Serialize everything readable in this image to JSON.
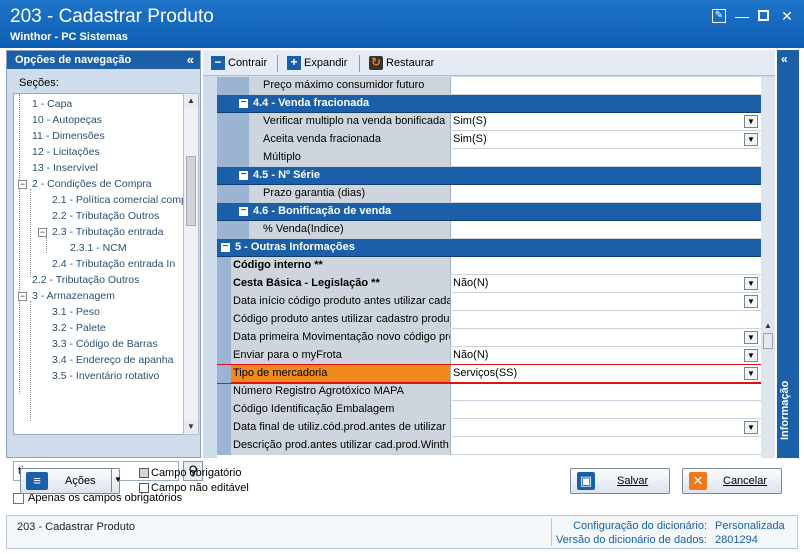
{
  "window": {
    "title": "203 - Cadastrar  Produto",
    "subtitle": "Winthor - PC Sistemas"
  },
  "nav": {
    "header": "Opções de navegação",
    "secoes_label": "Seções:",
    "tree": [
      {
        "label": "1 - Capa"
      },
      {
        "label": "10 - Autopeças"
      },
      {
        "label": "11 - Dimensões"
      },
      {
        "label": "12 - Licitações"
      },
      {
        "label": "13 - Inservível"
      },
      {
        "label": "2 - Condições de Compra"
      },
      {
        "label": "2.1 - Política comercial comp"
      },
      {
        "label": "2.2 - Tributação Outros"
      },
      {
        "label": "2.3 - Tributação entrada"
      },
      {
        "label": "2.3.1 - NCM"
      },
      {
        "label": "2.4 - Tributação entrada In"
      },
      {
        "label": "2.2 - Tributação Outros"
      },
      {
        "label": "3 - Armazenagem"
      },
      {
        "label": "3.1 - Peso"
      },
      {
        "label": "3.2 - Palete"
      },
      {
        "label": "3.3 - Código de Barras"
      },
      {
        "label": "3.4 - Endereço de apanha"
      },
      {
        "label": "3.5 - Inventário rotativo"
      }
    ],
    "search_value": "tipo merc",
    "only_required_label": "Apenas os campos obrigatórios"
  },
  "toolbar": {
    "contrair": "Contrair",
    "expandir": "Expandir",
    "restaurar": "Restaurar"
  },
  "grid": {
    "rows": [
      {
        "type": "field",
        "level": 2,
        "label": "Preço máximo consumidor futuro",
        "value": ""
      },
      {
        "type": "group",
        "level": 2,
        "label": "4.4 - Venda fracionada"
      },
      {
        "type": "field",
        "level": 2,
        "label": "Verificar multiplo na venda bonificada",
        "value": "Sim(S)",
        "dropdown": true
      },
      {
        "type": "field",
        "level": 2,
        "label": "Aceita venda fracionada",
        "value": "Sim(S)",
        "dropdown": true
      },
      {
        "type": "field",
        "level": 2,
        "label": "Múltiplo",
        "value": ""
      },
      {
        "type": "group",
        "level": 2,
        "label": "4.5 - Nº Série"
      },
      {
        "type": "field",
        "level": 2,
        "label": "Prazo garantia (dias)",
        "value": ""
      },
      {
        "type": "group",
        "level": 2,
        "label": "4.6 - Bonificação de venda"
      },
      {
        "type": "field",
        "level": 2,
        "label": "% Venda(Indice)",
        "value": ""
      },
      {
        "type": "group",
        "level": 1,
        "label": "5 - Outras Informações"
      },
      {
        "type": "field",
        "level": 1,
        "label": "Código interno **",
        "value": "",
        "bold": true
      },
      {
        "type": "field",
        "level": 1,
        "label": "Cesta Básica - Legislação **",
        "value": "Não(N)",
        "dropdown": true,
        "bold": true
      },
      {
        "type": "field",
        "level": 1,
        "label": "Data início código produto antes utilizar cada",
        "value": "",
        "dropdown": true
      },
      {
        "type": "field",
        "level": 1,
        "label": "Código produto antes utilizar cadastro produ",
        "value": ""
      },
      {
        "type": "field",
        "level": 1,
        "label": "Data primeira Movimentação novo código pro",
        "value": "",
        "dropdown": true
      },
      {
        "type": "field",
        "level": 1,
        "label": "Enviar para o myFrota",
        "value": "Não(N)",
        "dropdown": true
      },
      {
        "type": "field",
        "level": 1,
        "label": "Tipo de mercadoria",
        "value": "Serviços(SS)",
        "dropdown": true,
        "highlight": true
      },
      {
        "type": "field",
        "level": 1,
        "label": "Número Registro Agrotóxico MAPA",
        "value": ""
      },
      {
        "type": "field",
        "level": 1,
        "label": "Código Identificação Embalagem",
        "value": ""
      },
      {
        "type": "field",
        "level": 1,
        "label": "Data final de utiliz.cód.prod.antes de utilizar",
        "value": "",
        "dropdown": true
      },
      {
        "type": "field",
        "level": 1,
        "label": "Descrição prod.antes utilizar cad.prod.Winth",
        "value": ""
      }
    ]
  },
  "info_panel": {
    "label": "Informação"
  },
  "bottom": {
    "acoes": "Ações",
    "legend_required": "Campo obrigatório",
    "legend_readonly": "Campo não editável",
    "salvar": "Salvar",
    "cancelar": "Cancelar"
  },
  "status": {
    "left": "203 - Cadastrar  Produto",
    "config_label": "Configuração do dicionário:",
    "config_value": "Personalizada",
    "version_label": "Versão do dicionário de dados:",
    "version_value": "2801294"
  },
  "colors": {
    "title_bar": "#1e74c9",
    "group_header": "#1b5fa9",
    "highlight_border": "#e01010",
    "highlight_fill": "#f08a1c"
  }
}
